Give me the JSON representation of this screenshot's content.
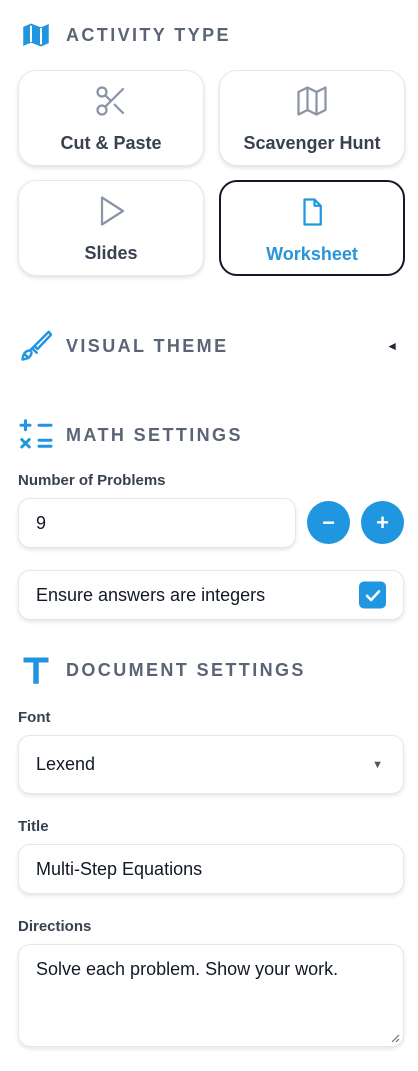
{
  "activity_type": {
    "title": "ACTIVITY TYPE",
    "options": [
      {
        "label": "Cut & Paste",
        "icon": "scissors-icon",
        "selected": false
      },
      {
        "label": "Scavenger Hunt",
        "icon": "map-icon",
        "selected": false
      },
      {
        "label": "Slides",
        "icon": "play-icon",
        "selected": false
      },
      {
        "label": "Worksheet",
        "icon": "file-icon",
        "selected": true
      }
    ]
  },
  "visual_theme": {
    "title": "VISUAL THEME",
    "toggle": "◄"
  },
  "math_settings": {
    "title": "MATH SETTINGS",
    "number_label": "Number of Problems",
    "number_value": "9",
    "decrement": "−",
    "increment": "+",
    "integers_label": "Ensure answers are integers",
    "integers_checked": true
  },
  "document_settings": {
    "title": "DOCUMENT SETTINGS",
    "font_label": "Font",
    "font_value": "Lexend",
    "font_arrow": "▼",
    "title_label": "Title",
    "title_value": "Multi-Step Equations",
    "directions_label": "Directions",
    "directions_value": "Solve each problem. Show your work."
  },
  "colors": {
    "accent": "#2196e0",
    "heading": "#5a6476",
    "selected_label": "#2a94d6"
  }
}
